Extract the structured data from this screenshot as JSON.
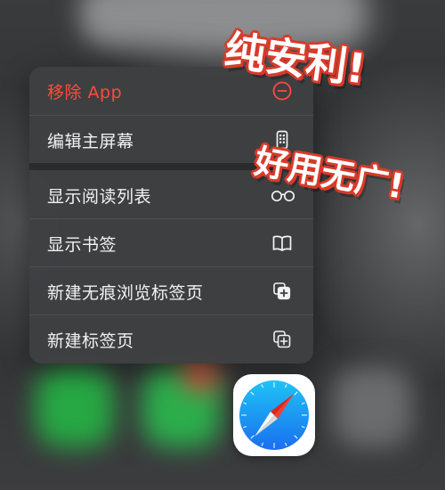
{
  "menu": {
    "items": [
      {
        "label": "移除 App",
        "icon": "minus-circle-icon",
        "destructive": true
      },
      {
        "label": "编辑主屏幕",
        "icon": "phone-apps-icon",
        "destructive": false
      },
      {
        "label": "显示阅读列表",
        "icon": "glasses-icon",
        "destructive": false
      },
      {
        "label": "显示书签",
        "icon": "book-icon",
        "destructive": false
      },
      {
        "label": "新建无痕浏览标签页",
        "icon": "private-tab-icon",
        "destructive": false
      },
      {
        "label": "新建标签页",
        "icon": "new-tab-icon",
        "destructive": false
      }
    ]
  },
  "dock": {
    "safari_icon": "safari-compass-icon"
  },
  "stickers": {
    "text_1": "纯安利!",
    "text_2": "好用无广!"
  },
  "colors": {
    "destructive": "#ff4a3d",
    "menu_text": "#f2f2f2",
    "sticker_outline": "#d93a2a",
    "safari_blue": "#1d8cf0"
  }
}
